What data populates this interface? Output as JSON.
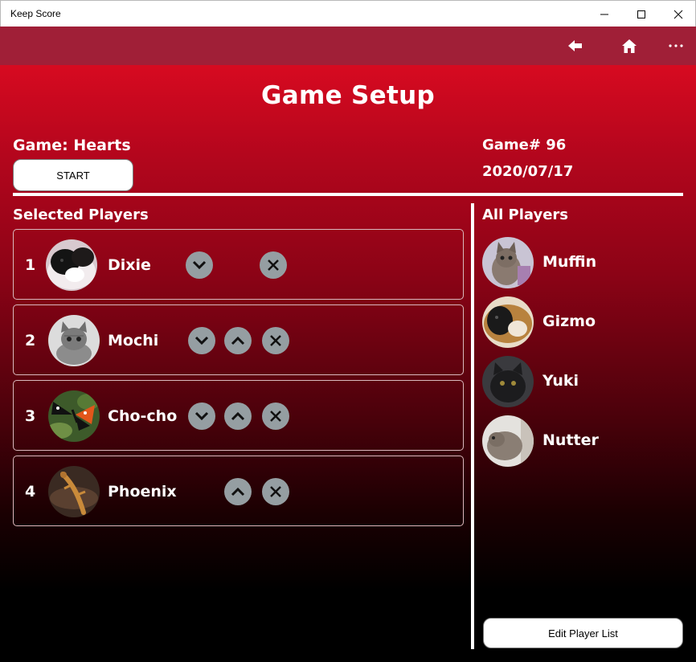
{
  "window": {
    "title": "Keep Score"
  },
  "appbar": {
    "back_icon": "back-arrow-icon",
    "home_icon": "home-icon",
    "more_icon": "more-icon",
    "color": "#a01f37"
  },
  "page": {
    "title": "Game Setup"
  },
  "game": {
    "name": "Game: Hearts",
    "number": "Game# 96",
    "date": "2020/07/17",
    "start_label": "START"
  },
  "selected": {
    "label": "Selected Players",
    "players": [
      {
        "index": "1",
        "name": "Dixie",
        "avatar": "guinea-pig-photo",
        "buttons": [
          "move-down",
          "remove"
        ]
      },
      {
        "index": "2",
        "name": "Mochi",
        "avatar": "kitten-photo",
        "buttons": [
          "move-down",
          "move-up",
          "remove"
        ]
      },
      {
        "index": "3",
        "name": "Cho-cho",
        "avatar": "butterfly-photo",
        "buttons": [
          "move-down",
          "move-up",
          "remove"
        ]
      },
      {
        "index": "4",
        "name": "Phoenix",
        "avatar": "lizard-photo",
        "buttons": [
          "move-up",
          "remove"
        ]
      }
    ]
  },
  "all": {
    "label": "All Players",
    "players": [
      {
        "name": "Muffin",
        "avatar": "kitten-photo"
      },
      {
        "name": "Gizmo",
        "avatar": "guinea-pig-photo"
      },
      {
        "name": "Yuki",
        "avatar": "black-cat-photo"
      },
      {
        "name": "Nutter",
        "avatar": "squirrel-photo"
      }
    ],
    "edit_label": "Edit Player List"
  },
  "colors": {
    "accent_top": "#d70a20",
    "button_gray": "#959ea2"
  }
}
